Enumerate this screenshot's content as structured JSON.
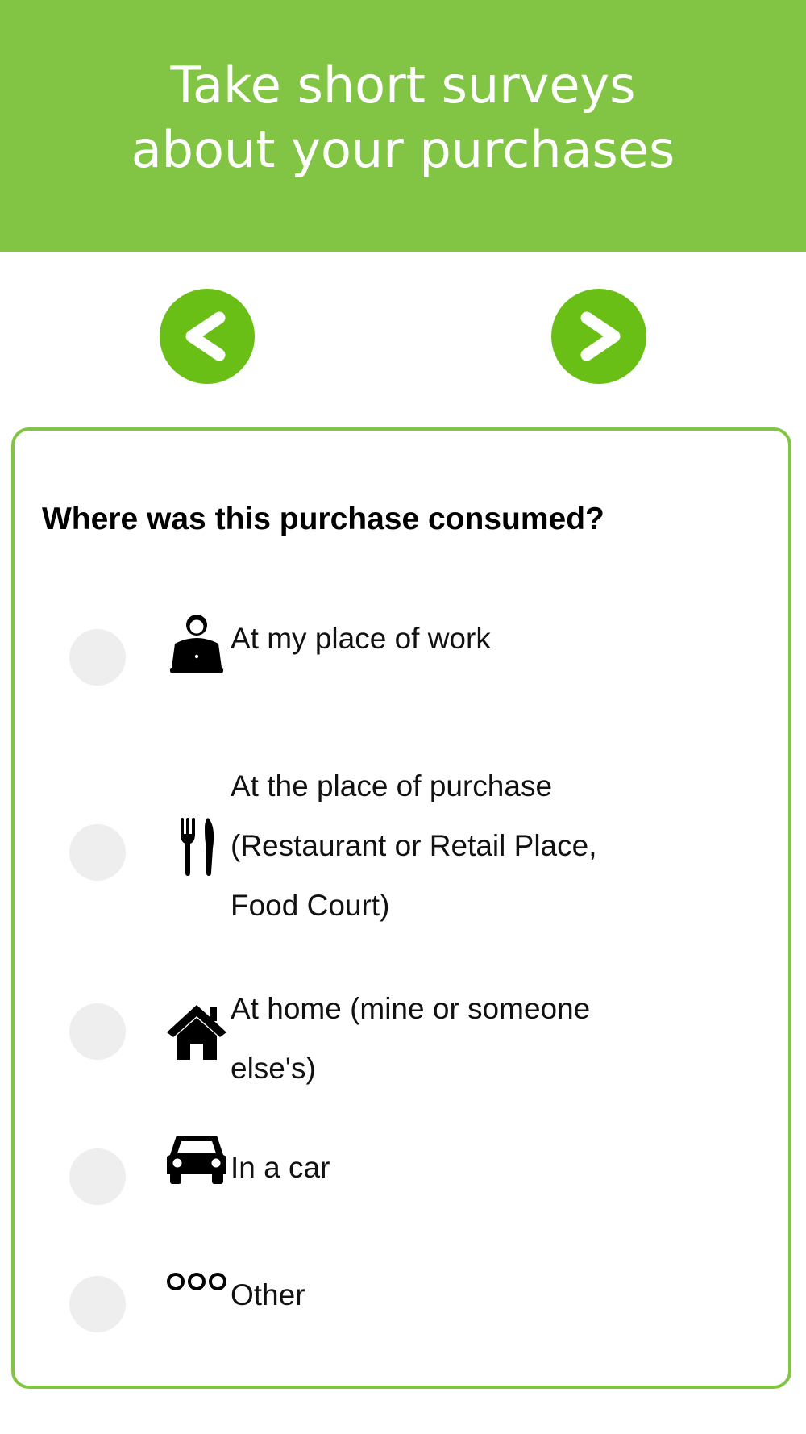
{
  "banner": {
    "title": "Take short surveys\nabout your purchases",
    "color": "#82c443"
  },
  "nav": {
    "prev": {
      "glyph": "<",
      "icon": "chevron-left-icon"
    },
    "next": {
      "glyph": ">",
      "icon": "chevron-right-icon"
    },
    "color": "#6abf17"
  },
  "survey": {
    "question": "Where was this purchase consumed?",
    "options": [
      {
        "label": "At my place of work",
        "icon": "worker-laptop-icon",
        "selected": false
      },
      {
        "label": "At the place of purchase\n(Restaurant or Retail Place,\nFood Court)",
        "icon": "fork-knife-icon",
        "selected": false
      },
      {
        "label": "At home (mine or someone\nelse's)",
        "icon": "home-icon",
        "selected": false
      },
      {
        "label": "In a car",
        "icon": "car-icon",
        "selected": false
      },
      {
        "label": "Other",
        "icon": "ellipsis-circles-icon",
        "selected": false
      }
    ]
  }
}
